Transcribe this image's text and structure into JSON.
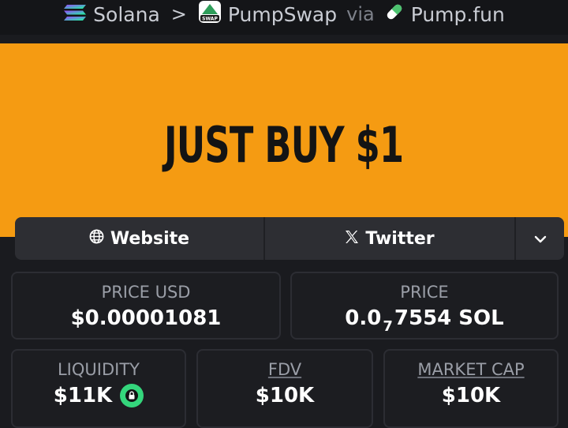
{
  "breadcrumb": {
    "chain": "Solana",
    "separator": ">",
    "dex": "PumpSwap",
    "via": "via",
    "launchpad": "Pump.fun"
  },
  "banner": {
    "text": "JUST BUY $1"
  },
  "links": {
    "website": "Website",
    "twitter": "Twitter"
  },
  "stats": {
    "price_usd_label": "PRICE USD",
    "price_usd_value": "$0.00001081",
    "price_label": "PRICE",
    "price_prefix": "0.0",
    "price_zeros": "7",
    "price_suffix": "7554 SOL",
    "liquidity_label": "LIQUIDITY",
    "liquidity_value": "$11K",
    "fdv_label": "FDV",
    "fdv_value": "$10K",
    "mcap_label": "MARKET CAP",
    "mcap_value": "$10K"
  },
  "colors": {
    "banner": "#f59b12",
    "background": "#1a1b1f",
    "lock_badge": "#34d67c"
  },
  "icons": [
    "solana-icon",
    "pumpswap-icon",
    "pill-icon",
    "globe-icon",
    "x-icon",
    "chevron-down-icon",
    "lock-icon"
  ]
}
